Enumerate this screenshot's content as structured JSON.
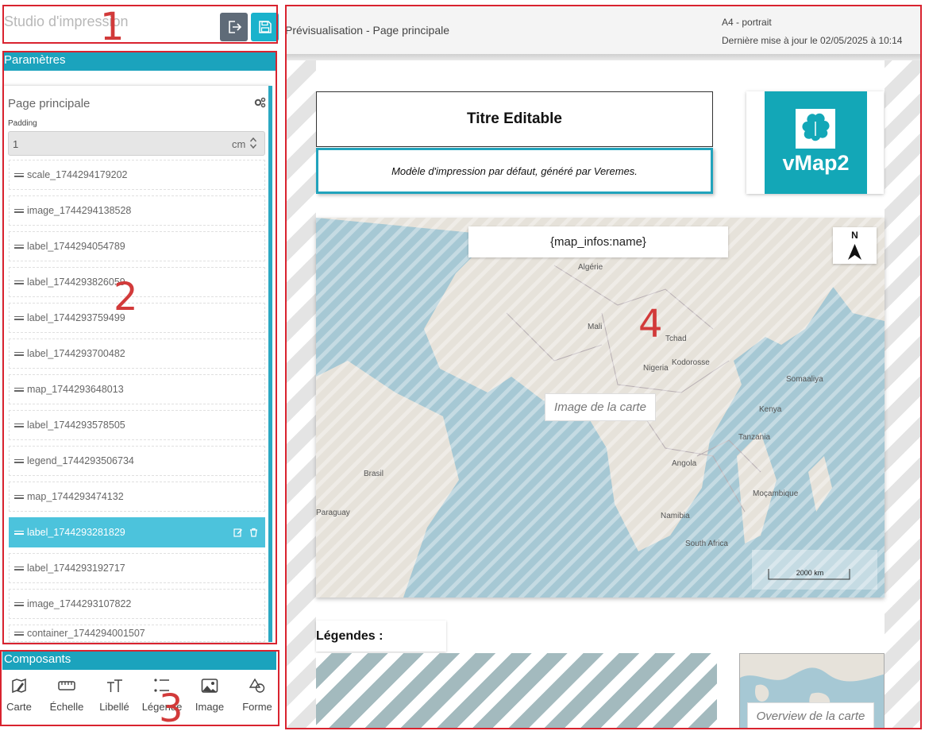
{
  "header": {
    "studio_title": "Studio d'impression",
    "exit_icon": "exit-icon",
    "save_icon": "save-icon"
  },
  "sections": {
    "parameters": "Paramètres",
    "components": "Composants"
  },
  "page_settings": {
    "title": "Page principale",
    "padding_label": "Padding",
    "padding_value": "1",
    "padding_unit": "cm"
  },
  "layers": [
    {
      "name": "scale_1744294179202"
    },
    {
      "name": "image_1744294138528"
    },
    {
      "name": "label_1744294054789"
    },
    {
      "name": "label_1744293826059"
    },
    {
      "name": "label_1744293759499"
    },
    {
      "name": "label_1744293700482"
    },
    {
      "name": "map_1744293648013"
    },
    {
      "name": "label_1744293578505"
    },
    {
      "name": "legend_1744293506734"
    },
    {
      "name": "map_1744293474132"
    },
    {
      "name": "label_1744293281829"
    },
    {
      "name": "label_1744293192717"
    },
    {
      "name": "image_1744293107822"
    },
    {
      "name": "container_1744294001507"
    }
  ],
  "selected_layer": "label_1744293281829",
  "components": [
    {
      "label": "Carte",
      "icon": "map-edit-icon"
    },
    {
      "label": "Échelle",
      "icon": "ruler-icon"
    },
    {
      "label": "Libellé",
      "icon": "text-icon"
    },
    {
      "label": "Légende",
      "icon": "list-icon"
    },
    {
      "label": "Image",
      "icon": "image-icon"
    },
    {
      "label": "Forme",
      "icon": "shapes-icon"
    }
  ],
  "preview": {
    "title": "Prévisualisation - Page principale",
    "format": "A4 - portrait",
    "updated": "Dernière mise à jour le 02/05/2025 à 10:14"
  },
  "page": {
    "title": "Titre Editable",
    "subtitle": "Modèle d'impression par défaut, généré par Veremes.",
    "logo_text": "vMap2",
    "map_name": "{map_infos:name}",
    "north_label": "N",
    "map_image_label": "Image de la carte",
    "scale_text": "2000 km",
    "legend_title": "Légendes :",
    "overview_label": "Overview de la carte",
    "map_place_labels": [
      "Algérie",
      "Mali",
      "Tchad",
      "Nigeria",
      "Kodorosse",
      "Somaaliya",
      "Kenya",
      "Tanzania",
      "Angola",
      "Namibia",
      "Moçambique",
      "South Africa",
      "Brasil",
      "Paraguay"
    ]
  },
  "annotations": [
    "1",
    "2",
    "3",
    "4"
  ],
  "colors": {
    "accent": "#1ba3bd",
    "selected": "#4cc3dc",
    "logo_bg": "#13a7b7",
    "annotation_red": "#d9232f",
    "ocean": "#a6c8d4",
    "land": "#e6e2da"
  }
}
